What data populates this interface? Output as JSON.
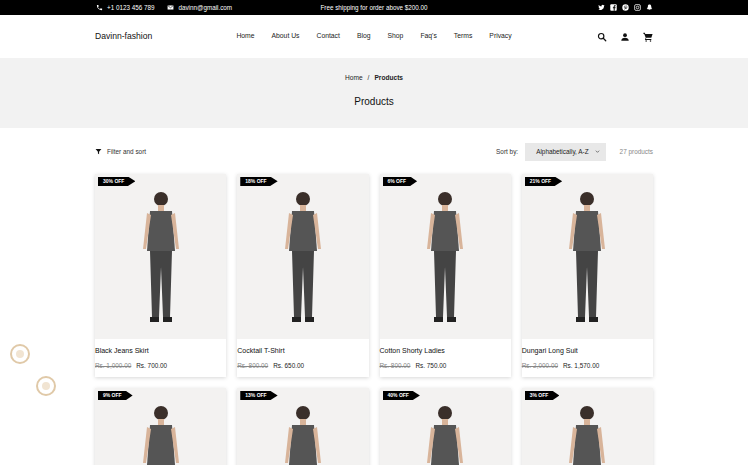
{
  "topbar": {
    "phone": "+1 0123 456 789",
    "email": "davinn@gmail.com",
    "promo": "Free shipping for order above $200.00"
  },
  "header": {
    "logo": "Davinn-fashion",
    "nav": [
      "Home",
      "About Us",
      "Contact",
      "Blog",
      "Shop",
      "Faq's",
      "Terms",
      "Privacy"
    ]
  },
  "breadcrumb": {
    "items": [
      {
        "label": "Home",
        "selected": false
      },
      {
        "label": "Products",
        "selected": true
      }
    ],
    "separator": "/",
    "title": "Products"
  },
  "toolbar": {
    "filter": "Filter and sort",
    "sort_label": "Sort by:",
    "sort_value": "Alphabetically, A-Z",
    "count": "27 products"
  },
  "products": [
    {
      "badge": "30% OFF",
      "name": "Black Jeans Skirt",
      "price_old": "Rs. 1,000.00",
      "price": "Rs. 700.00"
    },
    {
      "badge": "18% OFF",
      "name": "Cocktail T-Shirt",
      "price_old": "Rs. 800.00",
      "price": "Rs. 650.00"
    },
    {
      "badge": "6% OFF",
      "name": "Cotton Shorty Ladies",
      "price_old": "Rs. 800.00",
      "price": "Rs. 750.00"
    },
    {
      "badge": "21% OFF",
      "name": "Dungari Long Suit",
      "price_old": "Rs. 2,000.00",
      "price": "Rs. 1,570.00"
    },
    {
      "badge": "9% OFF"
    },
    {
      "badge": "13% OFF"
    },
    {
      "badge": "40% OFF"
    },
    {
      "badge": "3% OFF"
    }
  ]
}
